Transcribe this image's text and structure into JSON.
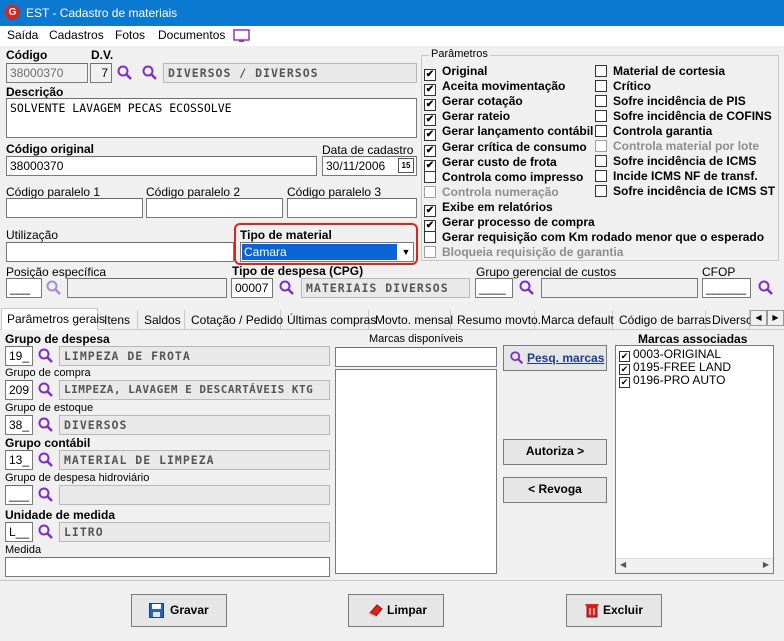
{
  "window": {
    "title": "EST - Cadastro de materiais",
    "app_icon": "G"
  },
  "menu": [
    "Saída",
    "Cadastros",
    "Fotos",
    "Documentos"
  ],
  "header": {
    "codigo_label": "Código",
    "codigo_value": "38000370",
    "dv_label": "D.V.",
    "dv_value": "7",
    "grupo_desc": "DIVERSOS / DIVERSOS",
    "descricao_label": "Descrição",
    "descricao_value": "SOLVENTE LAVAGEM PECAS ECOSSOLVE",
    "codigo_original_label": "Código original",
    "codigo_original_value": "38000370",
    "data_cadastro_label": "Data de cadastro",
    "data_cadastro_value": "30/11/2006",
    "calendar_label": "15",
    "cod_paralelo1_label": "Código paralelo 1",
    "cod_paralelo2_label": "Código paralelo 2",
    "cod_paralelo3_label": "Código paralelo 3",
    "utilizacao_label": "Utilização",
    "tipo_material_label": "Tipo de material",
    "tipo_material_value": "Camara",
    "posicao_label": "Posição específica",
    "posicao_value": "___",
    "tipo_despesa_label": "Tipo de despesa (CPG)",
    "tipo_despesa_code": "00007",
    "tipo_despesa_desc": "MATERIAIS DIVERSOS",
    "grupo_gerencial_label": "Grupo gerencial de custos",
    "grupo_gerencial_value": "____",
    "cfop_label": "CFOP",
    "cfop_value": "______"
  },
  "parametros": {
    "title": "Parâmetros",
    "col1": [
      {
        "label": "Original",
        "checked": true,
        "enabled": true
      },
      {
        "label": "Aceita movimentação",
        "checked": true,
        "enabled": true
      },
      {
        "label": "Gerar cotação",
        "checked": true,
        "enabled": true
      },
      {
        "label": "Gerar rateio",
        "checked": true,
        "enabled": true
      },
      {
        "label": "Gerar lançamento contábil",
        "checked": true,
        "enabled": true
      },
      {
        "label": "Gerar crítica de consumo",
        "checked": true,
        "enabled": true
      },
      {
        "label": "Gerar custo de frota",
        "checked": true,
        "enabled": true
      },
      {
        "label": "Controla como impresso",
        "checked": false,
        "enabled": true
      },
      {
        "label": "Controla numeração",
        "checked": false,
        "enabled": false
      },
      {
        "label": "Exibe em relatórios",
        "checked": true,
        "enabled": true
      },
      {
        "label": "Gerar processo de compra",
        "checked": true,
        "enabled": true
      },
      {
        "label": "Gerar requisição com Km rodado menor que o esperado",
        "checked": false,
        "enabled": true
      },
      {
        "label": "Bloqueia requisição de garantia",
        "checked": false,
        "enabled": false
      }
    ],
    "col2": [
      {
        "label": "Material de cortesia",
        "checked": false,
        "enabled": true
      },
      {
        "label": "Crítico",
        "checked": false,
        "enabled": true
      },
      {
        "label": "Sofre incidência de PIS",
        "checked": false,
        "enabled": true
      },
      {
        "label": "Sofre incidência de COFINS",
        "checked": false,
        "enabled": true
      },
      {
        "label": "Controla garantia",
        "checked": false,
        "enabled": true
      },
      {
        "label": "Controla material por lote",
        "checked": false,
        "enabled": false
      },
      {
        "label": "Sofre incidência de ICMS",
        "checked": false,
        "enabled": true
      },
      {
        "label": "Incide ICMS NF de transf.",
        "checked": false,
        "enabled": true
      },
      {
        "label": "Sofre incidência de ICMS ST",
        "checked": false,
        "enabled": true
      }
    ]
  },
  "tabs": [
    "Parâmetros gerais",
    "Itens",
    "Saldos",
    "Cotação / Pedido",
    "Últimas compras",
    "Movto. mensal",
    "Resumo movto.",
    "Marca default",
    "Código de barras",
    "Diversos"
  ],
  "gerais": {
    "grupo_despesa_label": "Grupo de despesa",
    "grupo_despesa_code": "19_",
    "grupo_despesa_desc": "LIMPEZA DE FROTA",
    "grupo_compra_label": "Grupo de compra",
    "grupo_compra_code": "209",
    "grupo_compra_desc": "LIMPEZA, LAVAGEM E DESCARTÁVEIS KTG",
    "grupo_estoque_label": "Grupo de estoque",
    "grupo_estoque_code": "38_",
    "grupo_estoque_desc": "DIVERSOS",
    "grupo_contabil_label": "Grupo contábil",
    "grupo_contabil_code": "13_",
    "grupo_contabil_desc": "MATERIAL DE LIMPEZA",
    "grupo_hidro_label": "Grupo de despesa hidroviário",
    "grupo_hidro_code": "___",
    "unidade_label": "Unidade de medida",
    "unidade_code": "L__",
    "unidade_desc": "LITRO",
    "medida_label": "Medida"
  },
  "marcas": {
    "disponiveis_label": "Marcas disponíveis",
    "pesq_button": "Pesq. marcas",
    "autoriza_button": "Autoriza >",
    "revoga_button": "< Revoga",
    "associadas_label": "Marcas associadas",
    "associadas": [
      "0003-ORIGINAL",
      "0195-FREE LAND",
      "0196-PRO AUTO"
    ]
  },
  "footer": {
    "gravar": "Gravar",
    "limpar": "Limpar",
    "excluir": "Excluir"
  },
  "colors": {
    "titlebar": "#0b79d0",
    "highlight": "#d9251c",
    "selection": "#0a64d6"
  }
}
